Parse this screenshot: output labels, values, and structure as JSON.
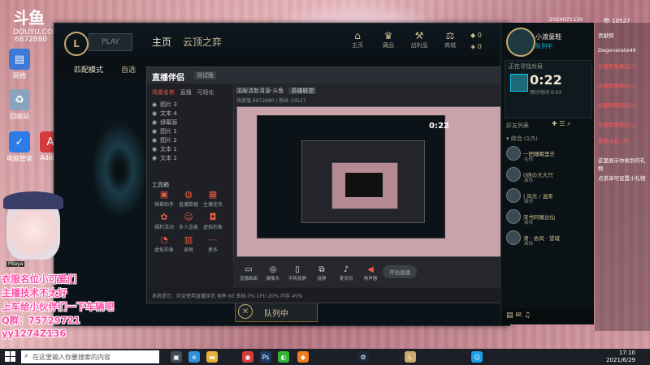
{
  "desktop": {
    "logo": {
      "mark": "斗鱼",
      "sub": "DOUYU.COM"
    },
    "room_id": "6872880",
    "icons": [
      {
        "label": "网络",
        "icon": "network-icon",
        "color": "#3d7ad8"
      },
      {
        "label": "回收站",
        "icon": "recycle-bin-icon",
        "color": "#8aa4c0"
      },
      {
        "label": "电脑管家",
        "icon": "pc-manager-icon",
        "color": "#2b7be8"
      },
      {
        "label": "Adobe",
        "icon": "adobe-icon",
        "color": "#d63c3c"
      }
    ]
  },
  "stream_meta": {
    "date": "2024071110",
    "viewers": "10527"
  },
  "lol_client": {
    "logo_text": "L",
    "play_button": "PLAY",
    "nav": {
      "home": "主页",
      "tft": "云顶之弈"
    },
    "top_icons": [
      {
        "label": "主页",
        "icon": "home-icon"
      },
      {
        "label": "藏品",
        "icon": "collection-icon"
      },
      {
        "label": "战利品",
        "icon": "loot-icon"
      },
      {
        "label": "商城",
        "icon": "store-icon"
      }
    ],
    "currency": [
      {
        "icon": "blue-essence-icon",
        "value": "0"
      },
      {
        "icon": "rp-icon",
        "value": "0"
      }
    ],
    "mode_title": "匹配模式",
    "mode_sub": "自选",
    "queue_label": "队列中",
    "social": {
      "summoner_name": "小渡童鞋",
      "summoner_status": "队列中",
      "finding_title": "正在寻找对局",
      "finding_time": "0:22",
      "finding_sub": "预计时间 0:02",
      "friends_header": "好友列表",
      "friends_group": "▾ 综合 (1/5)",
      "friends": [
        {
          "name": "一把睡眠里去",
          "status": "在线"
        },
        {
          "name": "0倍の大大只",
          "status": "离线"
        },
        {
          "name": "| 风光 / 温柔",
          "status": "离线"
        },
        {
          "name": "宋书阿暖达仙",
          "status": "离线"
        },
        {
          "name": "清 · 依风 · 望城",
          "status": "离线"
        }
      ]
    }
  },
  "streamer_app": {
    "logo": "直播伴侣",
    "badge": "测试版",
    "tabs": [
      "场景名称",
      "直播",
      "可视化"
    ],
    "scenes": [
      "图片 3",
      "文本 4",
      "绿幕源",
      "图片 1",
      "图片 2",
      "文本 1",
      "文本 2"
    ],
    "tools_header": "工具箱",
    "tools": [
      {
        "label": "弹幕助手",
        "icon": "danmu-icon"
      },
      {
        "label": "直播数据",
        "icon": "data-icon"
      },
      {
        "label": "主播任务",
        "icon": "task-icon"
      },
      {
        "label": "福利活动",
        "icon": "gift-icon"
      },
      {
        "label": "多人连麦",
        "icon": "mic-link-icon"
      },
      {
        "label": "虚拟形象",
        "icon": "avatar-icon"
      },
      {
        "label": "虚拟形象",
        "icon": "virtual-icon"
      },
      {
        "label": "录屏",
        "icon": "record-icon"
      },
      {
        "label": "更多",
        "icon": "more-icon"
      }
    ],
    "room_title": "国服清新清源·斗鱼",
    "room_tag": "英雄联盟",
    "stats": "热度值 6872880 | 粉丝 10527",
    "preview_timer": "0:22",
    "toolbar": [
      {
        "label": "直播画面",
        "icon": "screen-icon"
      },
      {
        "label": "摄像头",
        "icon": "camera-icon"
      },
      {
        "label": "手机投屏",
        "icon": "phone-cast-icon"
      },
      {
        "label": "投屏",
        "icon": "cast-icon"
      },
      {
        "label": "麦克风",
        "icon": "mic-icon"
      },
      {
        "label": "扬声器",
        "icon": "speaker-icon"
      }
    ],
    "start_label": "开始直播",
    "status": "系统提示：欢迎使用直播伴侣  帧率 60  丢帧 0%  CPU 20%  内存 45%"
  },
  "chat": [
    {
      "text": "贡献榜",
      "red": false
    },
    {
      "text": "Degenerate49",
      "red": false
    },
    {
      "text": "长腿歌歌来玩儿!",
      "red": true
    },
    {
      "text": "长腿歌歌来玩儿!",
      "red": true
    },
    {
      "text": "长腿歌歌来玩儿!",
      "red": true
    },
    {
      "text": "长腿歌歌来玩儿!",
      "red": true
    },
    {
      "text": "我爱水淼_UP",
      "red": true
    },
    {
      "text": "这里展示你收到的礼物",
      "red": false
    },
    {
      "text": "点菜单可设置小礼物",
      "red": false
    }
  ],
  "streamer_cam": {
    "label": "Pitaya"
  },
  "captions": [
    "衣服名位小可爱们",
    "主播技术不太好",
    "上车给小伙伴们一下车辆吧",
    "Q群：75729721",
    "yy1274Z136"
  ],
  "taskbar": {
    "search_placeholder": "在这里输入你要搜索的内容",
    "apps": [
      {
        "icon": "task-view-icon",
        "color": "#444a55"
      },
      {
        "icon": "edge-icon",
        "color": "#2f8fd8"
      },
      {
        "icon": "folder-icon",
        "color": "#e6b23a"
      },
      {
        "icon": "netease-icon",
        "color": "#d43c3c"
      },
      {
        "icon": "photoshop-icon",
        "color": "#1d3a66"
      },
      {
        "icon": "wechat-icon",
        "color": "#35b535"
      },
      {
        "icon": "douyu-icon",
        "color": "#f07c1e"
      },
      {
        "icon": "steam-icon",
        "color": "#1b2838"
      },
      {
        "icon": "lol-icon",
        "color": "#c8aa6e"
      },
      {
        "icon": "qq-icon",
        "color": "#1aa0e8"
      }
    ],
    "time": "17:10",
    "date": "2021/6/29"
  }
}
